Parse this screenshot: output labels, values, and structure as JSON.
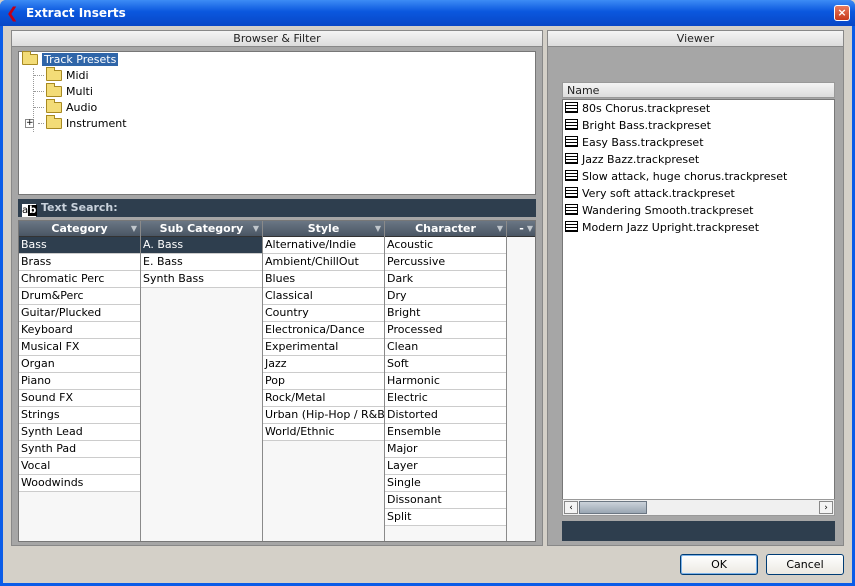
{
  "window": {
    "title": "Extract Inserts",
    "close_glyph": "×",
    "app_icon": "cubase-logo-icon"
  },
  "browser": {
    "header": "Browser & Filter",
    "tree": {
      "root": "Track Presets",
      "children": [
        "Midi",
        "Multi",
        "Audio",
        "Instrument"
      ],
      "expand_glyph": "+"
    },
    "search_label": "Text Search:",
    "search_icon_text": "a",
    "search_icon_text2": "b",
    "filter": {
      "columns": [
        {
          "title": "Category",
          "items": [
            "Bass",
            "Brass",
            "Chromatic Perc",
            "Drum&Perc",
            "Guitar/Plucked",
            "Keyboard",
            "Musical FX",
            "Organ",
            "Piano",
            "Sound FX",
            "Strings",
            "Synth Lead",
            "Synth Pad",
            "Vocal",
            "Woodwinds"
          ],
          "selected": 0
        },
        {
          "title": "Sub Category",
          "items": [
            "A. Bass",
            "E. Bass",
            "Synth Bass"
          ],
          "selected": 0
        },
        {
          "title": "Style",
          "items": [
            "Alternative/Indie",
            "Ambient/ChillOut",
            "Blues",
            "Classical",
            "Country",
            "Electronica/Dance",
            "Experimental",
            "Jazz",
            "Pop",
            "Rock/Metal",
            "Urban (Hip-Hop / R&B)",
            "World/Ethnic"
          ],
          "selected": -1
        },
        {
          "title": "Character",
          "items": [
            "Acoustic",
            "Percussive",
            "Dark",
            "Dry",
            "Bright",
            "Processed",
            "Clean",
            "Soft",
            "Harmonic",
            "Electric",
            "Distorted",
            "Ensemble",
            "Major",
            "Layer",
            "Single",
            "Dissonant",
            "Split"
          ],
          "selected": -1
        },
        {
          "title": "-",
          "items": [],
          "selected": -1
        }
      ],
      "dropdown_glyph": "▼"
    }
  },
  "viewer": {
    "header": "Viewer",
    "column_name": "Name",
    "files": [
      "80s Chorus.trackpreset",
      "Bright Bass.trackpreset",
      "Easy Bass.trackpreset",
      "Jazz Bazz.trackpreset",
      "Slow attack, huge chorus.trackpreset",
      "Very soft attack.trackpreset",
      "Wandering Smooth.trackpreset",
      "Modern Jazz Upright.trackpreset"
    ],
    "scroll_left": "‹",
    "scroll_right": "›"
  },
  "buttons": {
    "ok": "OK",
    "cancel": "Cancel"
  },
  "colors": {
    "titlebar": "#0a57de",
    "selection": "#2e3e4e",
    "tree_selection": "#2f65a8"
  }
}
